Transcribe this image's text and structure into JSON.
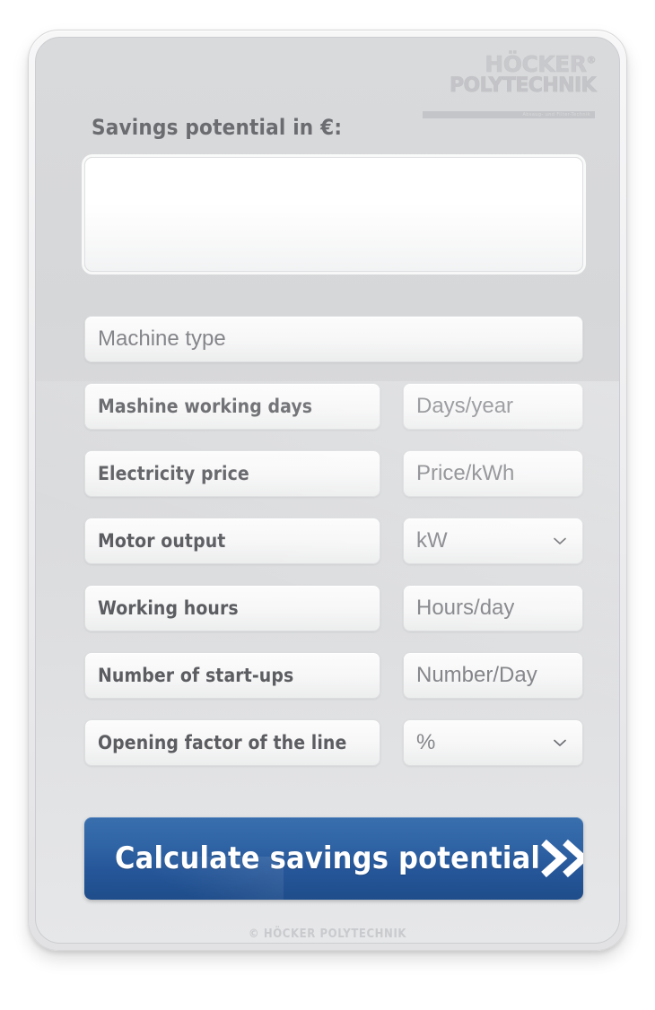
{
  "brand": {
    "logo_line1": "HÖCKER",
    "logo_registered": "®",
    "logo_line2": "POLYTECHNIK",
    "logo_tagline": "Absaug- und Filter-Technik",
    "accent_color": "#2f64a5",
    "panel_color": "#d9dadc"
  },
  "header": {
    "title": "Savings potential in €:"
  },
  "result": {
    "value": "",
    "placeholder": ""
  },
  "form": {
    "machine_type": {
      "placeholder": "Machine type",
      "value": ""
    },
    "rows": [
      {
        "label": "Mashine working days",
        "unit_placeholder": "Days/year",
        "unit_value": "",
        "control": "text"
      },
      {
        "label": "Electricity price",
        "unit_placeholder": "Price/kWh",
        "unit_value": "",
        "control": "text"
      },
      {
        "label": "Motor output",
        "unit_placeholder": "kW",
        "unit_value": "kW",
        "control": "select"
      },
      {
        "label": "Working hours",
        "unit_placeholder": "Hours/day",
        "unit_value": "",
        "control": "text"
      },
      {
        "label": "Number of start-ups",
        "unit_placeholder": "Number/Day",
        "unit_value": "",
        "control": "text"
      },
      {
        "label": "Opening factor of the line",
        "unit_placeholder": "%",
        "unit_value": "%",
        "control": "select"
      }
    ]
  },
  "actions": {
    "calculate_label": "Calculate savings potential",
    "calculate_icon": "double-chevron-right-icon"
  },
  "footer": {
    "copyright": "© HÖCKER POLYTECHNIK"
  }
}
